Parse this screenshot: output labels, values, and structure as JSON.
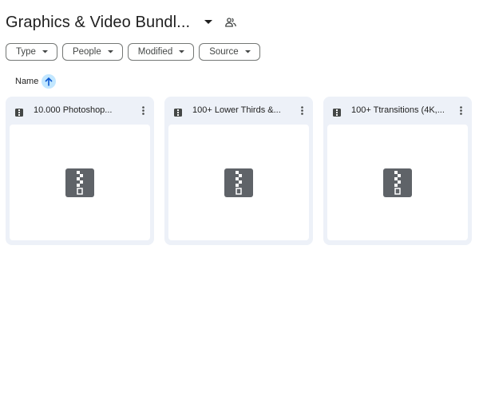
{
  "header": {
    "title": "Graphics & Video Bundl...",
    "caret_icon": "arrow-drop-down-icon",
    "shared_icon": "people-icon"
  },
  "filters": [
    {
      "label": "Type"
    },
    {
      "label": "People"
    },
    {
      "label": "Modified"
    },
    {
      "label": "Source"
    }
  ],
  "sort": {
    "label": "Name",
    "direction": "ascending",
    "icon": "arrow-up-icon"
  },
  "files": [
    {
      "name": "10.000 Photoshop...",
      "type_icon": "zip-file-icon"
    },
    {
      "name": "100+ Lower Thirds &...",
      "type_icon": "zip-file-icon"
    },
    {
      "name": "100+ Ttransitions (4K,...",
      "type_icon": "zip-file-icon"
    }
  ],
  "colors": {
    "card_bg": "#edf1f8",
    "sort_accent": "#c2e7ff",
    "icon_dark": "#5f6368"
  }
}
